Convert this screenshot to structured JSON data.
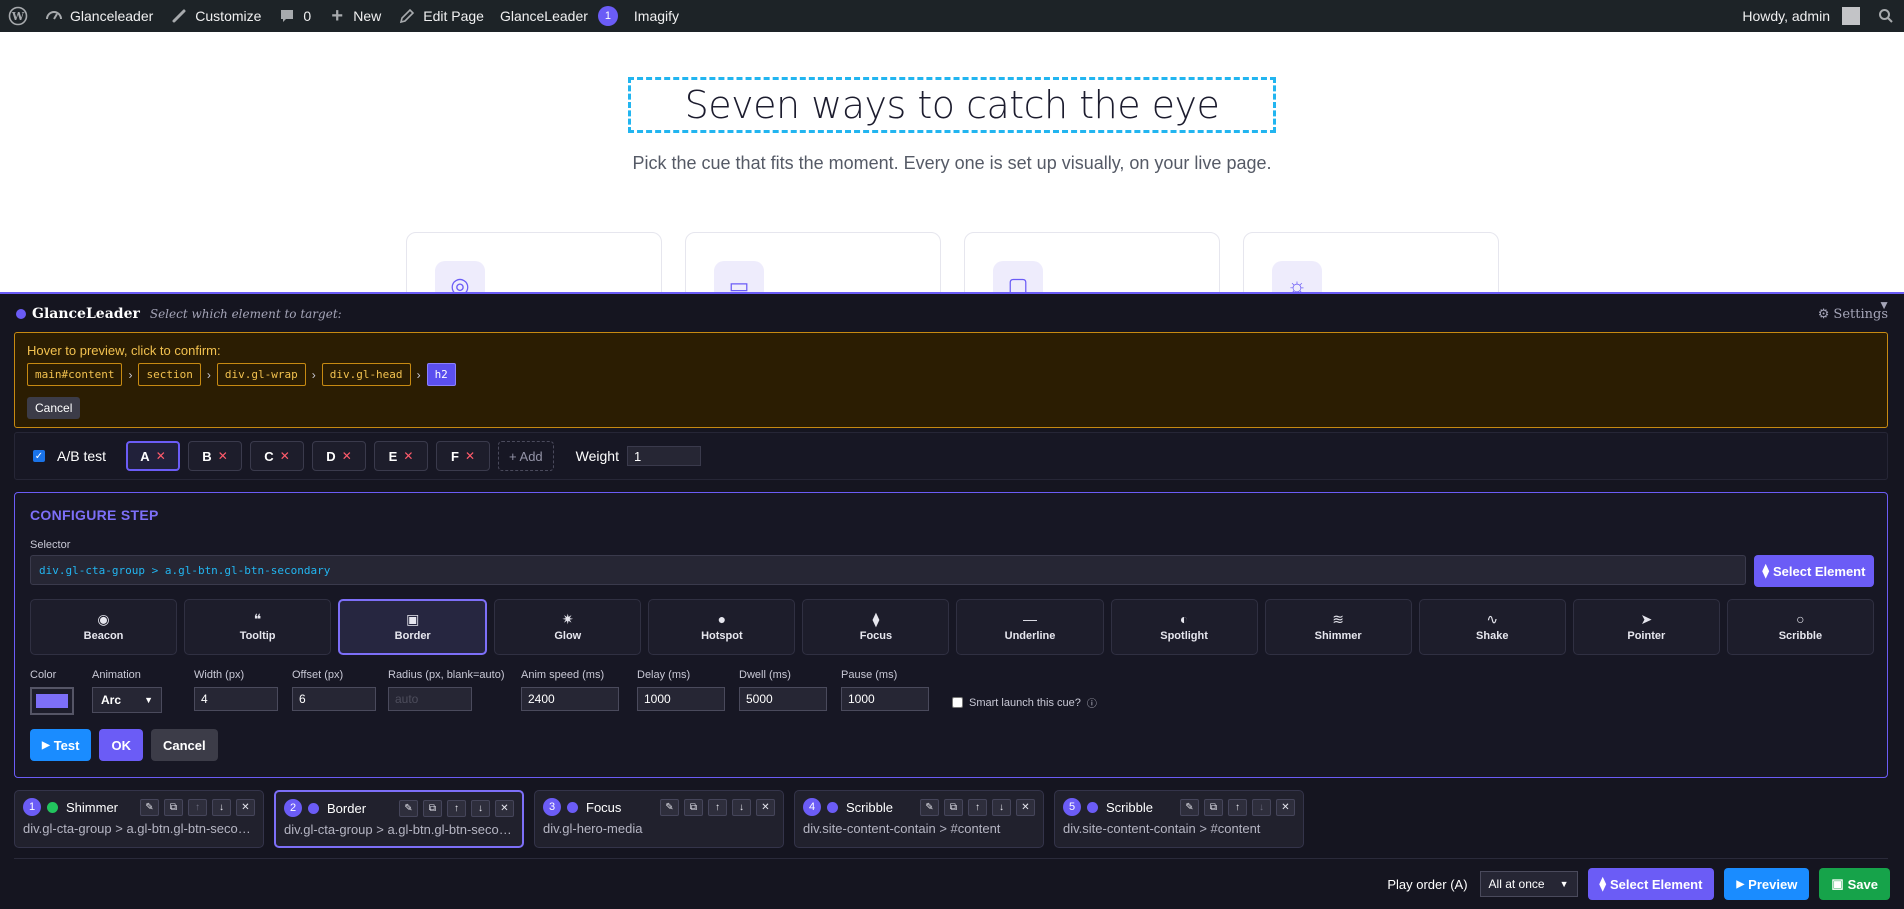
{
  "adminbar": {
    "wp_icon": "wordpress-icon",
    "site_name": "Glanceleader",
    "customize": "Customize",
    "comments_count": "0",
    "new": "New",
    "edit_page": "Edit Page",
    "plugin_name": "GlanceLeader",
    "plugin_badge": "1",
    "imagify": "Imagify",
    "howdy": "Howdy, admin"
  },
  "page": {
    "title": "Seven ways to catch the eye",
    "subtitle": "Pick the cue that fits the moment. Every one is set up visually, on your live page.",
    "feature_icons": [
      "beacon-icon",
      "tooltip-icon",
      "border-icon",
      "glow-icon"
    ]
  },
  "panel": {
    "brand": "GlanceLeader",
    "hint": "Select which element to target:",
    "settings": "Settings",
    "collapse": "▼"
  },
  "picker": {
    "hint": "Hover to preview, click to confirm:",
    "crumbs": [
      "main#content",
      "section",
      "div.gl-wrap",
      "div.gl-head",
      "h2"
    ],
    "cancel": "Cancel"
  },
  "abtest": {
    "label": "A/B test",
    "checked": true,
    "variants": [
      "A",
      "B",
      "C",
      "D",
      "E",
      "F"
    ],
    "active_variant": "A",
    "add": "+ Add",
    "weight_label": "Weight",
    "weight_value": "1"
  },
  "config": {
    "title": "CONFIGURE STEP",
    "selector_label": "Selector",
    "selector_value": "div.gl-cta-group > a.gl-btn.gl-btn-secondary",
    "select_element": "Select Element",
    "cues": [
      {
        "label": "Beacon",
        "icon": "◉"
      },
      {
        "label": "Tooltip",
        "icon": "❝"
      },
      {
        "label": "Border",
        "icon": "▣"
      },
      {
        "label": "Glow",
        "icon": "✷"
      },
      {
        "label": "Hotspot",
        "icon": "●"
      },
      {
        "label": "Focus",
        "icon": "⧫"
      },
      {
        "label": "Underline",
        "icon": "—"
      },
      {
        "label": "Spotlight",
        "icon": "◐"
      },
      {
        "label": "Shimmer",
        "icon": "≋"
      },
      {
        "label": "Shake",
        "icon": "∿"
      },
      {
        "label": "Pointer",
        "icon": "➤"
      },
      {
        "label": "Scribble",
        "icon": "○"
      }
    ],
    "active_cue": "Border",
    "params": {
      "color_label": "Color",
      "color_value": "#7d6ff8",
      "animation_label": "Animation",
      "animation_value": "Arc",
      "width_label": "Width (px)",
      "width_value": "4",
      "offset_label": "Offset (px)",
      "offset_value": "6",
      "radius_label": "Radius (px, blank=auto)",
      "radius_placeholder": "auto",
      "anim_speed_label": "Anim speed (ms)",
      "anim_speed_value": "2400",
      "delay_label": "Delay (ms)",
      "delay_value": "1000",
      "dwell_label": "Dwell (ms)",
      "dwell_value": "5000",
      "pause_label": "Pause (ms)",
      "pause_value": "1000",
      "smart_launch_label": "Smart launch this cue?"
    },
    "actions": {
      "test": "Test",
      "ok": "OK",
      "cancel": "Cancel"
    }
  },
  "steps": [
    {
      "num": "1",
      "name": "Shimmer",
      "selector": "div.gl-cta-group > a.gl-btn.gl-btn-secondary",
      "dot": "green",
      "active": false
    },
    {
      "num": "2",
      "name": "Border",
      "selector": "div.gl-cta-group > a.gl-btn.gl-btn-secondary",
      "dot": "purple",
      "active": true
    },
    {
      "num": "3",
      "name": "Focus",
      "selector": "div.gl-hero-media",
      "dot": "purple",
      "active": false
    },
    {
      "num": "4",
      "name": "Scribble",
      "selector": "div.site-content-contain > #content",
      "dot": "purple",
      "active": false
    },
    {
      "num": "5",
      "name": "Scribble",
      "selector": "div.site-content-contain > #content",
      "dot": "purple",
      "active": false
    }
  ],
  "footer": {
    "play_order_label": "Play order (A)",
    "play_order_value": "All at once",
    "select_element": "Select Element",
    "preview": "Preview",
    "save": "Save"
  }
}
